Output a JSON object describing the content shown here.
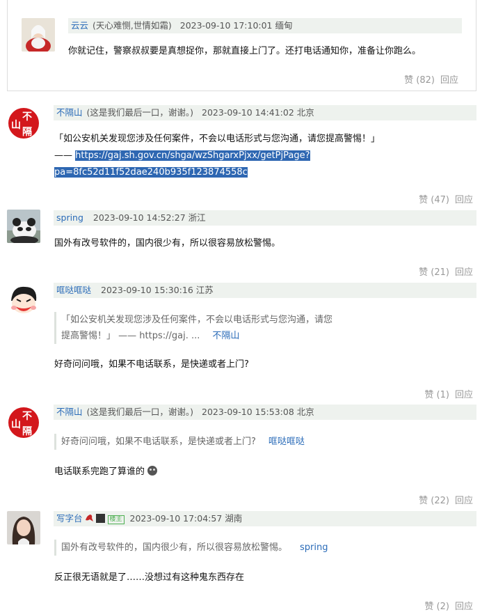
{
  "comments": [
    {
      "user": "云云",
      "signature": "(天心难恻,世情如霜)",
      "date": "2023-09-10 17:10:01",
      "location": "缅甸",
      "text": "你就记住，警察叔叔要是真想捉你，那就直接上门了。还打电话通知你，准备让你跑么。",
      "like_label": "赞 (82)",
      "reply_label": "回应"
    },
    {
      "user": "不隔山",
      "signature": "(这是我们最后一口，谢谢。)",
      "date": "2023-09-10 14:41:02",
      "location": "北京",
      "text_line1": "「如公安机关发现您涉及任何案件，不会以电话形式与您沟通，请您提高警惕！」",
      "text_dash": "——",
      "link_part1": "https://gaj.sh.gov.cn/shga/wzShgarxPjxx/getPjPage?",
      "link_part2": "pa=8fc52d11f52dae240b935f123874558c",
      "like_label": "赞 (47)",
      "reply_label": "回应",
      "avatar_chars": [
        "不",
        "山",
        "隔"
      ]
    },
    {
      "user": "spring",
      "date": "2023-09-10 14:52:27",
      "location": "浙江",
      "text": "国外有改号软件的，国内很少有，所以很容易放松警惕。",
      "like_label": "赞 (21)",
      "reply_label": "回应"
    },
    {
      "user": "哐哒哐哒",
      "date": "2023-09-10 15:30:16",
      "location": "江苏",
      "quote_line1": "「如公安机关发现您涉及任何案件，不会以电话形式与您沟通，请您",
      "quote_line2": "提高警惕！」 —— https://gaj. ...",
      "quote_author": "不隔山",
      "text": "好奇问问哦，如果不电话联系，是快递或者上门?",
      "like_label": "赞 (1)",
      "reply_label": "回应"
    },
    {
      "user": "不隔山",
      "signature": "(这是我们最后一口，谢谢。)",
      "date": "2023-09-10 15:53:08",
      "location": "北京",
      "quote_text": "好奇问问哦，如果不电话联系，是快递或者上门?",
      "quote_author": "哐哒哐哒",
      "text": "电话联系完跑了算谁的",
      "like_label": "赞 (22)",
      "reply_label": "回应",
      "avatar_chars": [
        "不",
        "山",
        "隔"
      ]
    },
    {
      "user": "写字台",
      "host_badge": "楼主",
      "date": "2023-09-10 17:04:57",
      "location": "湖南",
      "quote_text": "国外有改号软件的，国内很少有，所以很容易放松警惕。",
      "quote_author": "spring",
      "text": "反正很无语就是了……没想过有这种鬼东西存在",
      "like_label": "赞 (2)",
      "reply_label": "回应"
    }
  ],
  "colors": {
    "link": "#2a6bb8",
    "meta_bg": "#eef2ee",
    "selection": "#2e67b2",
    "muted": "#999999"
  }
}
